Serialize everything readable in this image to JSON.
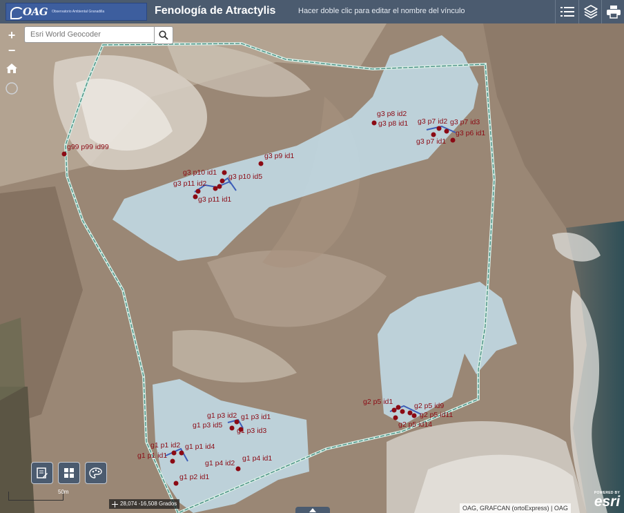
{
  "header": {
    "logo_text": "OAG",
    "logo_subtext": "Observatorio Ambiental Granadilla",
    "title": "Fenología de Atractylis",
    "subtitle": "Hacer doble clic para editar el nombre del vínculo",
    "buttons": [
      "legend-icon",
      "layers-icon",
      "print-icon"
    ]
  },
  "map_controls": {
    "zoom_in": "+",
    "zoom_out": "−",
    "home_icon": "home-icon",
    "locate_icon": "locate-icon"
  },
  "search": {
    "placeholder": "Esri World Geocoder",
    "value": "",
    "button_icon": "search-icon"
  },
  "widgets": [
    "edit-icon",
    "basemap-gallery-icon",
    "palette-icon"
  ],
  "labels": {
    "g99": "g99 p99 id99",
    "g3p8id2": "g3 p8 id2",
    "g3p8id1": "g3 p8 id1",
    "g3p7id2": "g3 p7 id2",
    "g3p7id3": "g3 p7 id3",
    "g3p6id1": "g3 p6 id1",
    "g3p7id1": "g3 p7 id1",
    "g3p9id1": "g3 p9 id1",
    "g3p10id1": "g3 p10 id1",
    "g3p10id5": "g3 p10 id5",
    "g3p11id2": "g3 p11 id2",
    "g3p11id1": "g3 p11 id1",
    "g2p5id1": "g2 p5 id1",
    "g2p5id9": "g2 p5 id9",
    "g2p5id11": "g2 p5 id11",
    "g2p5id14": "g2 p5 id14",
    "g1p3id2": "g1 p3 id2",
    "g1p3id1": "g1 p3 id1",
    "g1p3id5": "g1 p3 id5",
    "g1p3id3": "g1 p3 id3",
    "g1p1id2": "g1 p1 id2",
    "g1p1id4": "g1 p1 id4",
    "g1p1id1": "g1 p1 id1",
    "g1p4id2": "g1 p4 id2",
    "g1p4id1": "g1 p4 id1",
    "g1p2id1": "g1 p2 id1"
  },
  "footer": {
    "coordinates": "28,074 -16,508 Grados",
    "scale_label": "50m",
    "attribution": "OAG, GRAFCAN (ortoExpress) | OAG",
    "esri_powered": "POWERED BY",
    "esri_logo": "esri"
  },
  "colors": {
    "header_bg": "#4b5b6f",
    "polygon_fill": "#c6e4f2",
    "boundary_line": "#3f8a7d",
    "point_color": "#8b0a14",
    "label_color": "#8b0a14"
  }
}
